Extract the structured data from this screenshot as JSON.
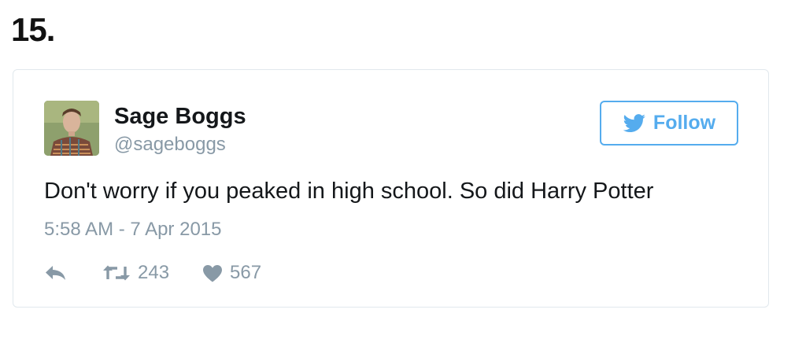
{
  "list_number": "15.",
  "tweet": {
    "author_name": "Sage Boggs",
    "author_handle": "@sageboggs",
    "follow_label": "Follow",
    "text": "Don't worry if you peaked in high school. So did Harry Potter",
    "timestamp": "5:58 AM - 7 Apr 2015",
    "retweet_count": "243",
    "like_count": "567"
  },
  "icons": {
    "follow": "twitter-bird-icon",
    "reply": "reply-icon",
    "retweet": "retweet-icon",
    "like": "heart-icon"
  },
  "colors": {
    "twitter_blue": "#55acee",
    "muted_text": "#8899a6",
    "card_border": "#e1e8ed"
  }
}
